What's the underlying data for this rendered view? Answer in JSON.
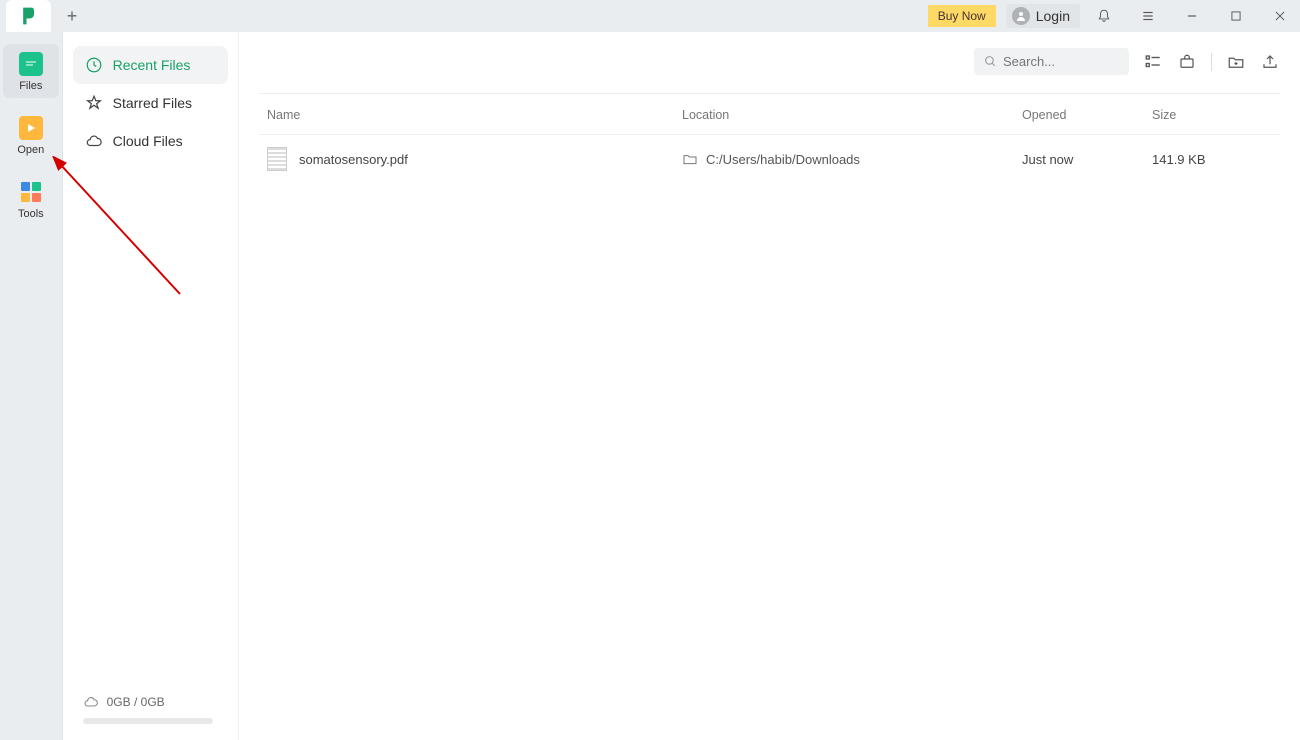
{
  "titlebar": {
    "buy_now": "Buy Now",
    "login": "Login"
  },
  "nav": {
    "files": "Files",
    "open": "Open",
    "tools": "Tools"
  },
  "sidebar": {
    "recent": "Recent Files",
    "starred": "Starred Files",
    "cloud": "Cloud Files",
    "storage": "0GB / 0GB"
  },
  "search": {
    "placeholder": "Search..."
  },
  "columns": {
    "name": "Name",
    "location": "Location",
    "opened": "Opened",
    "size": "Size"
  },
  "files": [
    {
      "name": "somatosensory.pdf",
      "location": "C:/Users/habib/Downloads",
      "opened": "Just now",
      "size": "141.9 KB"
    }
  ]
}
